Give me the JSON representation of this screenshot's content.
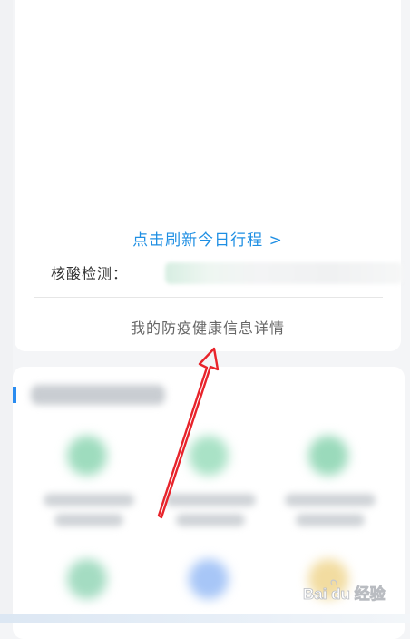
{
  "health_card": {
    "refresh_link": "点击刷新今日行程 >",
    "nucleic_label": "核酸检测：",
    "detail_link": "我的防疫健康信息详情"
  },
  "watermark": {
    "text": "Bai du 经验"
  },
  "colors": {
    "link_blue": "#1f8fe3",
    "annotation_red": "#e8232b",
    "section_accent": "#2a8cf0"
  }
}
